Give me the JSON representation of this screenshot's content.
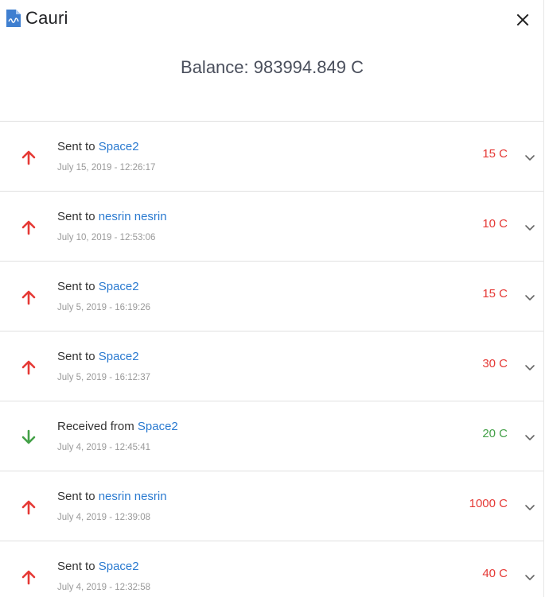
{
  "header": {
    "title": "Cauri",
    "icon": "document-icon"
  },
  "balance": {
    "label": "Balance: 983994.849 C"
  },
  "colors": {
    "sent": "#e53935",
    "received": "#43a047",
    "party_link": "#2a7ad0"
  },
  "transactions": [
    {
      "direction": "sent",
      "action": "Sent to",
      "party": "Space2",
      "date": "July 15, 2019 - 12:26:17",
      "amount": "15 C"
    },
    {
      "direction": "sent",
      "action": "Sent to",
      "party": "nesrin nesrin",
      "date": "July 10, 2019 - 12:53:06",
      "amount": "10 C"
    },
    {
      "direction": "sent",
      "action": "Sent to",
      "party": "Space2",
      "date": "July 5, 2019 - 16:19:26",
      "amount": "15 C"
    },
    {
      "direction": "sent",
      "action": "Sent to",
      "party": "Space2",
      "date": "July 5, 2019 - 16:12:37",
      "amount": "30 C"
    },
    {
      "direction": "received",
      "action": "Received from",
      "party": "Space2",
      "date": "July 4, 2019 - 12:45:41",
      "amount": "20 C"
    },
    {
      "direction": "sent",
      "action": "Sent to",
      "party": "nesrin nesrin",
      "date": "July 4, 2019 - 12:39:08",
      "amount": "1000 C"
    },
    {
      "direction": "sent",
      "action": "Sent to",
      "party": "Space2",
      "date": "July 4, 2019 - 12:32:58",
      "amount": "40 C"
    }
  ]
}
